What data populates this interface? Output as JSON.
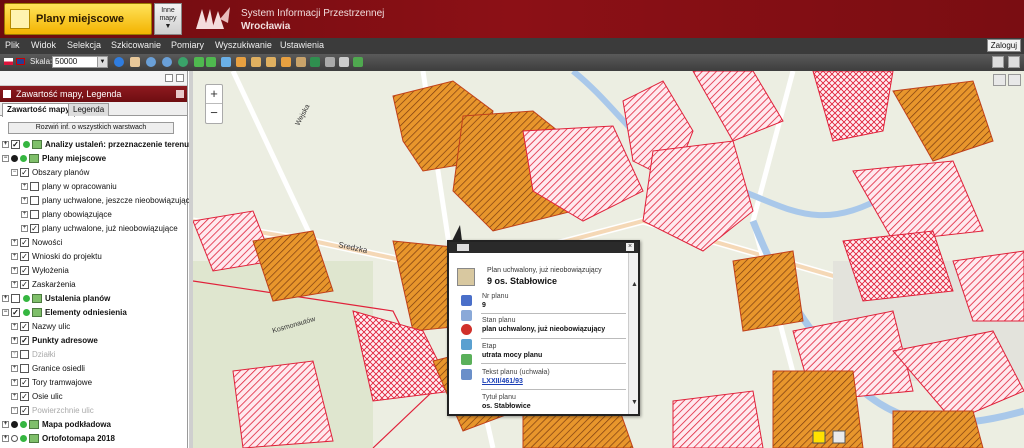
{
  "header": {
    "app_button": "Plany miejscowe",
    "other_maps": "Inne mapy",
    "title_line1": "System Informacji Przestrzennej",
    "title_line2": "Wrocławia"
  },
  "menu": {
    "items": [
      "Plik",
      "Widok",
      "Selekcja",
      "Szkicowanie",
      "Pomiary",
      "Wyszukiwanie",
      "Ustawienia"
    ],
    "login": "Zaloguj"
  },
  "toolbar": {
    "scale_label": "Skala:",
    "scale_value": "50000"
  },
  "panel": {
    "title": "Zawartość mapy, Legenda",
    "tabs": [
      "Zawartość mapy",
      "Legenda"
    ],
    "expand_button": "Rozwiń inf. o wszystkich warstwach",
    "layers": [
      "Analizy ustaleń: przeznaczenie terenu",
      "Plany miejscowe",
      "Obszary planów",
      "plany w opracowaniu",
      "plany uchwalone, jeszcze nieobowiązujące",
      "plany obowiązujące",
      "plany uchwalone, już nieobowiązujące",
      "Nowości",
      "Wnioski do projektu",
      "Wyłożenia",
      "Zaskarżenia",
      "Ustalenia planów",
      "Elementy odniesienia",
      "Nazwy ulic",
      "Punkty adresowe",
      "Działki",
      "Granice osiedli",
      "Tory tramwajowe",
      "Osie ulic",
      "Powierzchnie ulic",
      "Mapa podkładowa",
      "Ortofotomapa 2018"
    ]
  },
  "map": {
    "labels": [
      "Sredzka",
      "Wejska",
      "Kosmonautów"
    ]
  },
  "popup": {
    "type": "Plan uchwalony, już nieobowiązujący",
    "name": "9 os. Stabłowice",
    "fields": [
      {
        "label": "Nr planu",
        "value": "9"
      },
      {
        "label": "Stan planu",
        "value": "plan uchwalony, już nieobowiązujący"
      },
      {
        "label": "Etap",
        "value": "utrata mocy planu"
      },
      {
        "label": "Tekst planu (uchwała)",
        "value": "LXXII/461/93"
      },
      {
        "label": "Tytuł planu",
        "value": "os. Stabłowice"
      }
    ]
  },
  "colors": {
    "header": "#7a0d12",
    "menu": "#3b3b3b",
    "app_button": "#f3b300",
    "plan_hatch": "#e0213a",
    "plan_orange": "#e8962c"
  }
}
